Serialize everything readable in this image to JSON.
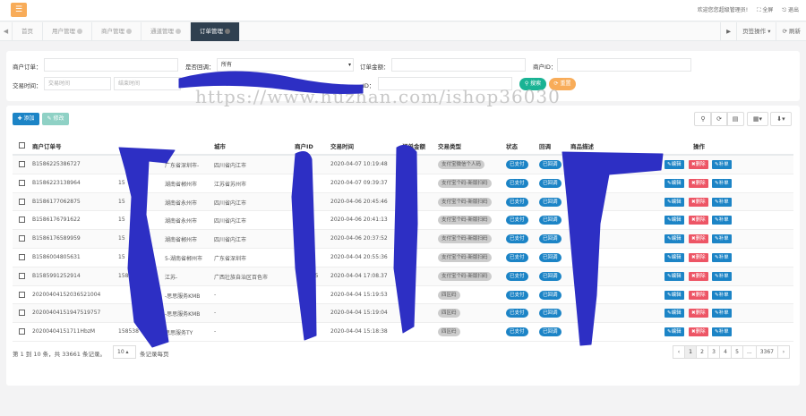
{
  "topbar": {
    "welcome": "欢迎您您超级管理员!",
    "fullscreen": "全屏",
    "logout": "退出"
  },
  "tabs": [
    {
      "label": "首页"
    },
    {
      "label": "用户管理"
    },
    {
      "label": "商户管理"
    },
    {
      "label": "通道管理"
    },
    {
      "label": "订单管理"
    }
  ],
  "tab_right": {
    "ops": "页签操作",
    "refresh": "刷新"
  },
  "filter": {
    "merchant_order_label": "商户订单：",
    "is_callback_label": "是否回调：",
    "is_callback_value": "所有",
    "amount_label": "订单金额：",
    "merchant_id_label": "商户ID：",
    "trade_time_label": "交易时间：",
    "start_placeholder": "交易时间",
    "end_placeholder": "结束时间",
    "id_label": "ID：",
    "search_btn": "搜索",
    "reset_btn": "重置"
  },
  "toolbar": {
    "add": "添加",
    "edit": "修改"
  },
  "columns": [
    "商户订单号",
    "",
    "城市",
    "商户ID",
    "交易时间",
    "订单金额",
    "交易类型",
    "状态",
    "回调",
    "商品描述",
    "操作"
  ],
  "rows": [
    {
      "order": "B1586225386727",
      "c2a": "",
      "c2b": "广东省深圳市-",
      "city": "四川省内江市",
      "mid": "",
      "time": "2020-04-07 10:19:48",
      "type": "支付宝微信个人码",
      "status": "已支付",
      "cb": "已回调"
    },
    {
      "order": "B1586223138964",
      "c2a": "15",
      "c2b": "湖南省郴州市",
      "city": "江苏省苏州市",
      "mid": "",
      "time": "2020-04-07 09:39:37",
      "type": "支付宝个码-新版扫码",
      "status": "已支付",
      "cb": "已回调"
    },
    {
      "order": "B1586177062875",
      "c2a": "15",
      "c2b": "湖南省永州市",
      "city": "四川省内江市",
      "mid": "",
      "time": "2020-04-06 20:45:46",
      "type": "支付宝个码-新版扫码",
      "status": "已支付",
      "cb": "已回调"
    },
    {
      "order": "B1586176791622",
      "c2a": "15",
      "c2b": "湖南省永州市",
      "city": "四川省内江市",
      "mid": "",
      "time": "2020-04-06 20:41:13",
      "type": "支付宝个码-新版扫码",
      "status": "已支付",
      "cb": "已回调"
    },
    {
      "order": "B1586176589959",
      "c2a": "15",
      "c2b": "湖南省郴州市",
      "city": "四川省内江市",
      "mid": "5",
      "time": "2020-04-06 20:37:52",
      "type": "支付宝个码-新版扫码",
      "status": "已支付",
      "cb": "已回调"
    },
    {
      "order": "B1586004805631",
      "c2a": "15",
      "c2b": "5-湖南省郴州市",
      "city": "广东省深圳市",
      "mid": "5",
      "time": "2020-04-04 20:55:36",
      "type": "支付宝个码-新版扫码",
      "status": "已支付",
      "cb": "已回调"
    },
    {
      "order": "B1585991252914",
      "c2a": "158",
      "c2b": "江苏-",
      "city": "广西壮族自治区百色市",
      "mid": "115",
      "time": "2020-04-04 17:08.37",
      "type": "支付宝个码-新版扫码",
      "status": "已支付",
      "cb": "已回调"
    },
    {
      "order": "20200404152036521004",
      "c2a": "",
      "c2b": "-思思服务KMB",
      "city": "-",
      "mid": "76",
      "time": "2020-04-04 15:19:53",
      "type": "四区码",
      "status": "已支付",
      "cb": "已回调"
    },
    {
      "order": "20200404151947519757",
      "c2a": "",
      "c2b": "-思思服务KMB",
      "city": "-",
      "mid": "A",
      "time": "2020-04-04 15:19:04",
      "type": "四区码",
      "status": "已支付",
      "cb": "已回调"
    },
    {
      "order": "20200404151711HbzM",
      "c2a": "158538",
      "c2b": "思思服务TY",
      "city": "-",
      "mid": "T",
      "time": "2020-04-04 15:18:38",
      "type": "四区码",
      "status": "已支付",
      "cb": "已回调"
    }
  ],
  "row_ops": {
    "edit": "编辑",
    "delete": "删除",
    "resend": "补单"
  },
  "footer": {
    "summary": "第 1 到 10 条，共 33661 条记录。",
    "page_size": "10",
    "per_page": "条记录每页"
  },
  "pager": [
    "‹",
    "1",
    "2",
    "3",
    "4",
    "5",
    "...",
    "3367",
    "›"
  ],
  "watermark": "https://www.huzhan.com/ishop36030",
  "colors": {
    "sidebar": "#2f4050",
    "accent": "#1c84c6",
    "menu": "#f8ac59",
    "search": "#1ab394",
    "scribble": "#2d2fc4"
  }
}
